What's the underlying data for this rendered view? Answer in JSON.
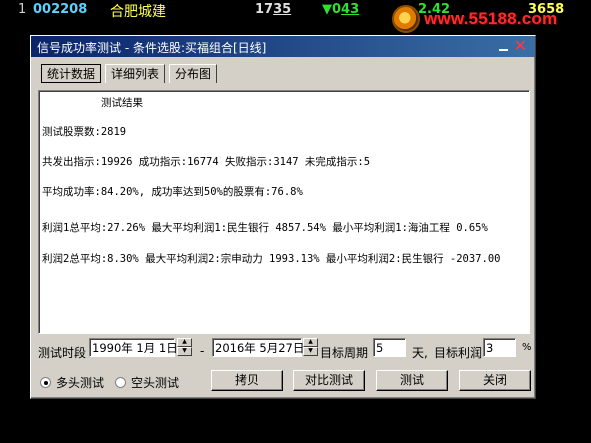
{
  "quote": {
    "index": "1",
    "code": "002208",
    "name": "合肥城建",
    "price_prefix": "17",
    "price_underlined": "35",
    "change_arrow": "▼",
    "change_prefix": "0",
    "change_underlined": "43",
    "change_pct": "2.42",
    "volume": "3658"
  },
  "watermark": {
    "text": "www.55188.com"
  },
  "dialog": {
    "title": "信号成功率测试 - 条件选股:买福组合[日线]",
    "tabs": [
      "统计数据",
      "详细列表",
      "分布图"
    ],
    "active_tab": 0,
    "results": {
      "heading": "测试结果",
      "stock_count": "测试股票数:2819",
      "signals": "共发出指示:19926 成功指示:16774 失败指示:3147 未完成指示:5",
      "success_rate": "平均成功率:84.20%, 成功率达到50%的股票有:76.8%",
      "profit1": "利润1总平均:27.26% 最大平均利润1:民生银行 4857.54% 最小平均利润1:海油工程 0.65%",
      "profit2": "利润2总平均:8.30% 最大平均利润2:宗申动力 1993.13% 最小平均利润2:民生银行 -2037.00"
    },
    "controls": {
      "period_label": "测试时段",
      "start_date": "1990年 1月 1日",
      "dash": "-",
      "end_date": "2016年 5月27日",
      "target_period_label": "目标周期",
      "target_period_value": "5",
      "days_label": "天,",
      "target_profit_label": "目标利润",
      "target_profit_value": "3",
      "percent": "%"
    },
    "mode": {
      "long_label": "多头测试",
      "short_label": "空头测试",
      "selected": "long"
    },
    "buttons": {
      "copy": "拷贝",
      "compare": "对比测试",
      "test": "测试",
      "close": "关闭"
    }
  }
}
